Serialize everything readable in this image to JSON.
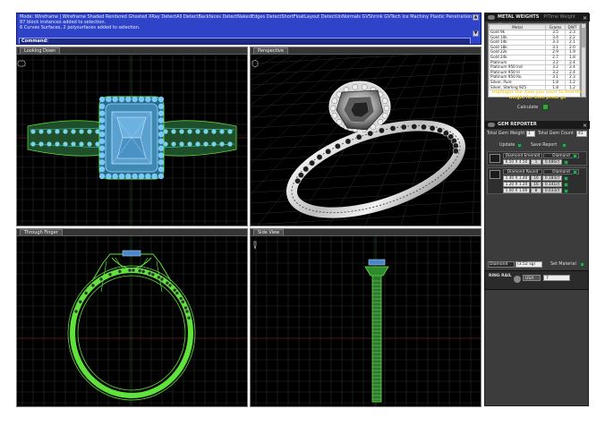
{
  "command": {
    "lines": [
      "Mode: Wireframe | Wireframe  Shaded  Rendered  Ghosted  XRay  DetectAll  DetectBackfaces  DetectNakedEdges  DetectShortFloatLayout  DetectUnNormals  GVShrink  GVTech  Ice  Machiny  Plastic  Penetration",
      "87 block instances added to selection.",
      "6 Curves Surfaces, 2 polysurfaces added to selection."
    ],
    "prompt": "Command:"
  },
  "viewports": {
    "top": "Looking Down",
    "perspective": "Perspective",
    "front": "Through Finger",
    "right": "Side View"
  },
  "panel": {
    "metal_weights": {
      "title": "METAL WEIGHTS",
      "subtitle": "PlTime Weight Checker",
      "columns": [
        "Metal",
        "Grams",
        "DWT"
      ],
      "rows": [
        [
          "Gold 9k",
          "3.5",
          "2.3"
        ],
        [
          "Gold 10k",
          "3.4",
          "2.2"
        ],
        [
          "Gold 14k",
          "3.3",
          "2.1"
        ],
        [
          "Gold 18k",
          "3.1",
          "2.0"
        ],
        [
          "Gold 22k",
          "2.9",
          "1.9"
        ],
        [
          "Gold 24k",
          "2.7",
          "1.8"
        ],
        [
          "Platinum",
          "3.2",
          "2.4"
        ],
        [
          "Platinum 950 Ind",
          "3.2",
          "2.4"
        ],
        [
          "Platinum 950 Iri",
          "3.2",
          "2.4"
        ],
        [
          "Platinum 950 Ru",
          "3.1",
          "2.3"
        ],
        [
          "Silver, Pure",
          "1.8",
          "1.2"
        ],
        [
          "Silver, Sterling 925",
          "1.8",
          "1.2"
        ]
      ],
      "hint": "Highlight the item you want to find the weight for then press go",
      "calculate": "Calculate"
    },
    "gem_reporter": {
      "title": "GEM REPORTER",
      "total_weight_label": "Total Gem Weight",
      "total_weight_value": "1",
      "total_count_label": "Total Gem Count",
      "total_count_value": "41",
      "update": "Update",
      "save_report": "Save Report",
      "groups": [
        {
          "shape": "Diamond Emerald",
          "type": "Diamond",
          "rows": [
            [
              "6.50 X 4.50",
              "1",
              "0.486ct"
            ]
          ]
        },
        {
          "shape": "Diamond Round",
          "type": "Diamond",
          "rows": [
            [
              "1.40 X 1.40",
              "16",
              "0.184ct"
            ],
            [
              "1.20 X 1.20",
              "16",
              "0.141ct"
            ],
            [
              "1.00 X 1.00",
              "8",
              "0.033ct"
            ]
          ]
        }
      ],
      "gem_select": "Diamond",
      "gem_select_value": "(3.52 sg)",
      "set_material": "Set Material"
    },
    "ring_rail": {
      "label": "RING RAIL",
      "unit": "USA",
      "size": "7"
    }
  }
}
